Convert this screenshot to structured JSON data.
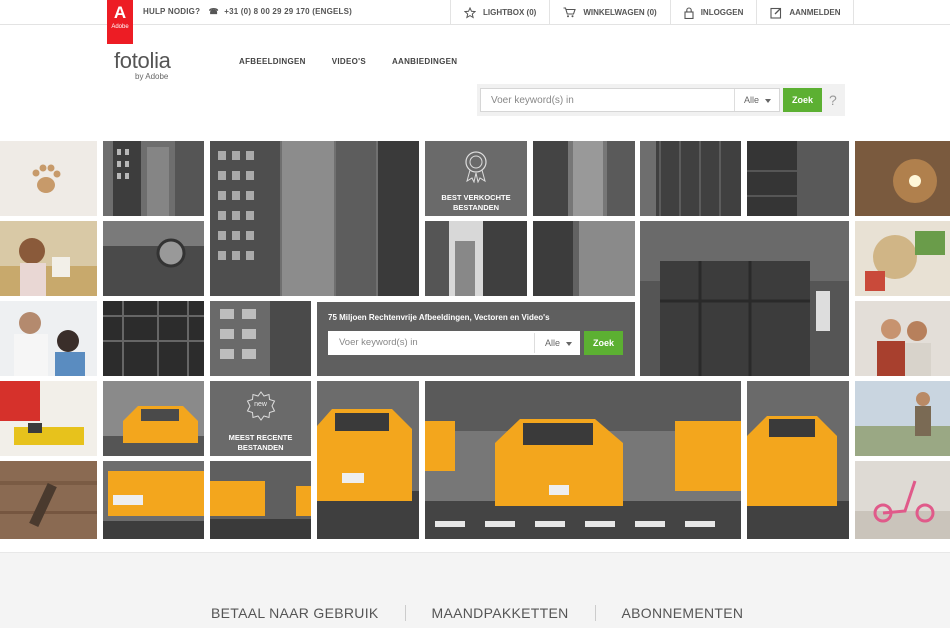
{
  "adobe_badge": {
    "mark": "A",
    "text": "Adobe"
  },
  "help": {
    "label": "HULP NODIG?",
    "phone": "+31 (0) 8 00 29 29 170 (ENGELS)"
  },
  "topnav": {
    "lightbox": "LIGHTBOX (0)",
    "cart": "WINKELWAGEN (0)",
    "login": "INLOGGEN",
    "signup": "AANMELDEN"
  },
  "brand": {
    "name": "fotolia",
    "by": "by Adobe"
  },
  "mainnav": [
    "AFBEELDINGEN",
    "VIDEO'S",
    "AANBIEDINGEN"
  ],
  "search": {
    "placeholder": "Voer keyword(s) in",
    "filter": "Alle",
    "button": "Zoek",
    "help": "?"
  },
  "hero": {
    "tagline": "75 Miljoen Rechtenvrije Afbeeldingen, Vectoren en Video's",
    "search_placeholder": "Voer keyword(s) in",
    "filter": "Alle",
    "button": "Zoek",
    "best_sellers": [
      "BEST VERKOCHTE",
      "BESTANDEN"
    ],
    "newest": [
      "MEEST RECENTE",
      "BESTANDEN"
    ],
    "new_badge": "new"
  },
  "plans": [
    "BETAAL NAAR GEBRUIK",
    "MAANDPAKKETTEN",
    "ABONNEMENTEN"
  ],
  "colors": {
    "accent_green": "#5cb032",
    "adobe_red": "#ed1c24",
    "taxi_yellow": "#f3a61d"
  }
}
